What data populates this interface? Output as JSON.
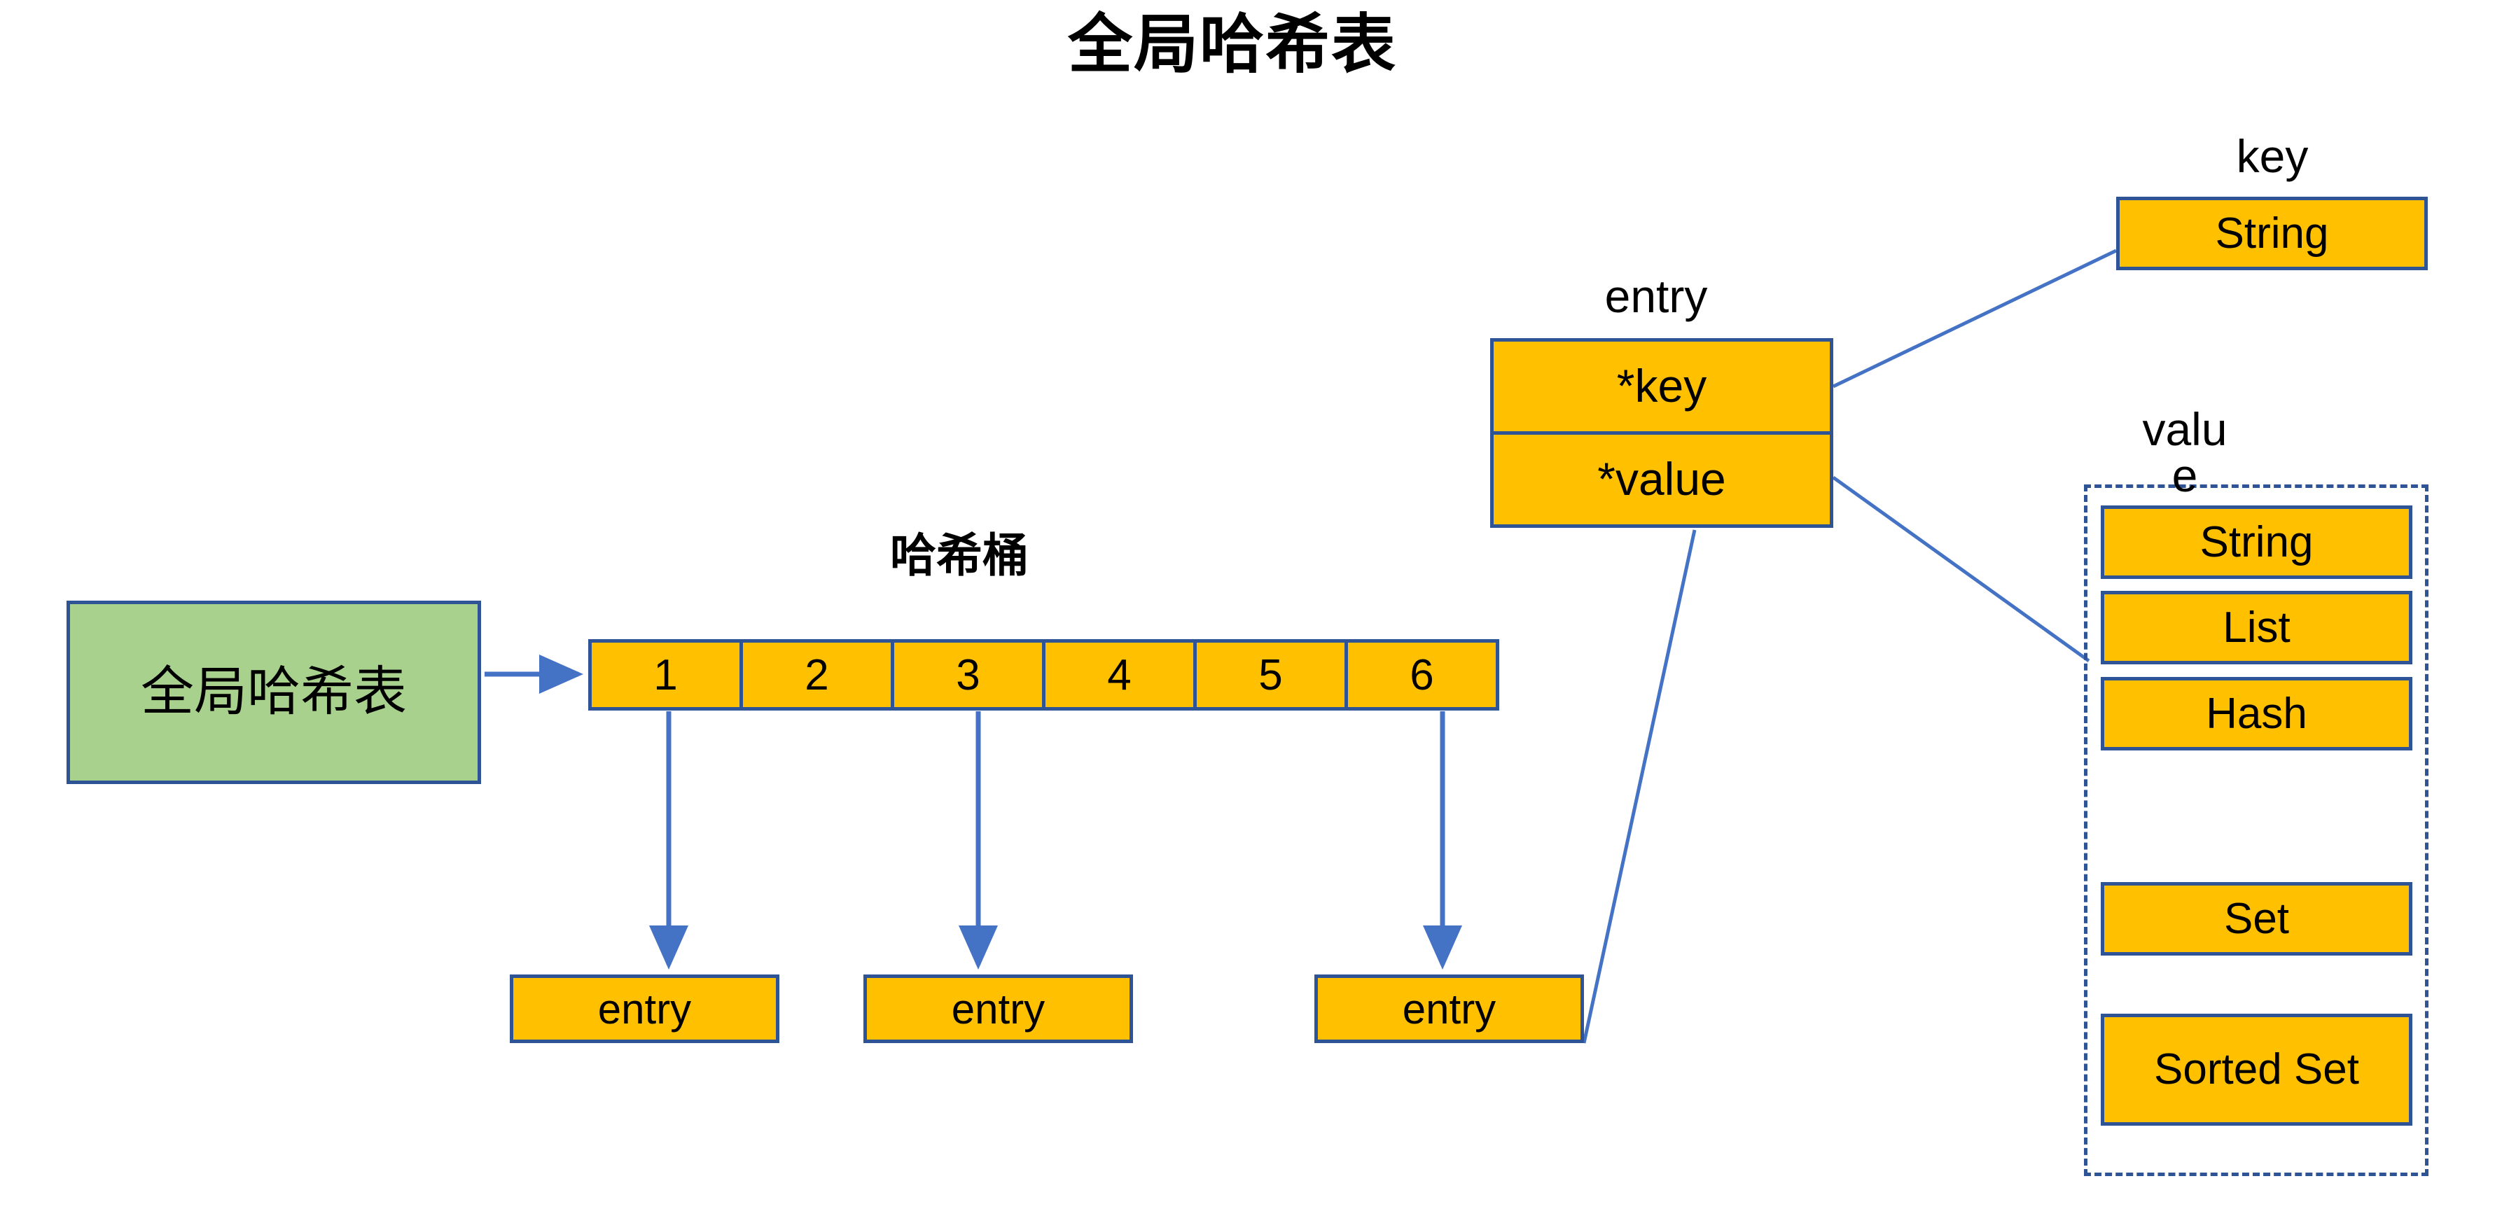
{
  "title": "全局哈希表",
  "colors": {
    "amber_fill": "#FFC000",
    "green_fill": "#A9D18E",
    "border_blue": "#2E5496",
    "connector_blue": "#4472C4",
    "text_black": "#000000",
    "background": "#FFFFFF"
  },
  "global_table": {
    "label": "全局哈希表"
  },
  "bucket": {
    "label": "哈希桶",
    "cells": [
      "1",
      "2",
      "3",
      "4",
      "5",
      "6"
    ]
  },
  "entries": [
    {
      "label": "entry"
    },
    {
      "label": "entry"
    },
    {
      "label": "entry"
    }
  ],
  "entry_struct": {
    "label": "entry",
    "fields": [
      {
        "label": "*key"
      },
      {
        "label": "*value"
      }
    ]
  },
  "key_group": {
    "label": "key",
    "types": [
      "String"
    ]
  },
  "value_group": {
    "label": "value",
    "types": [
      "String",
      "List",
      "Hash",
      "Set",
      "Sorted Set"
    ]
  }
}
